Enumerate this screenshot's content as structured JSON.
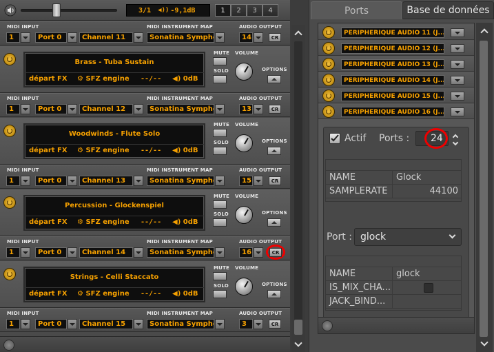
{
  "topbar": {
    "bar": "3/1",
    "volume": "-9,1dB",
    "pages": [
      "1",
      "2",
      "3",
      "4"
    ]
  },
  "labels": {
    "midi_input": "MIDI INPUT",
    "midi_map": "MIDI INSTRUMENT MAP",
    "audio_output": "AUDIO OUTPUT",
    "mute": "MUTE",
    "solo": "SOLO",
    "volume": "VOLUME",
    "options": "OPTIONS",
    "cr": "CR"
  },
  "midi_rows": [
    {
      "input": "1",
      "port": "Port 0",
      "channel": "Channel 11",
      "map": "Sonatina Sympho...",
      "output": "14"
    },
    {
      "input": "1",
      "port": "Port 0",
      "channel": "Channel 12",
      "map": "Sonatina Sympho...",
      "output": "13"
    },
    {
      "input": "1",
      "port": "Port 0",
      "channel": "Channel 13",
      "map": "Sonatina Sympho...",
      "output": "15"
    },
    {
      "input": "1",
      "port": "Port 0",
      "channel": "Channel 14",
      "map": "Sonatina Sympho...",
      "output": "16"
    },
    {
      "input": "1",
      "port": "Port 0",
      "channel": "Channel 15",
      "map": "Sonatina Sympho...",
      "output": "3"
    }
  ],
  "instruments": [
    {
      "title": "Brass - Tuba Sustain",
      "fx": "départ FX",
      "engine": "SFZ engine",
      "time": "--/--",
      "db": "0dB"
    },
    {
      "title": "Woodwinds - Flute Solo",
      "fx": "départ FX",
      "engine": "SFZ engine",
      "time": "--/--",
      "db": "0dB"
    },
    {
      "title": "Percussion - Glockenspiel",
      "fx": "départ FX",
      "engine": "SFZ engine",
      "time": "--/--",
      "db": "0dB"
    },
    {
      "title": "Strings - Celli Staccato",
      "fx": "départ FX",
      "engine": "SFZ engine",
      "time": "--/--",
      "db": "0dB"
    }
  ],
  "tabs": {
    "ports": "Ports",
    "database": "Base de données"
  },
  "devices": [
    "PERIPHERIQUE AUDIO 11 (J...",
    "PERIPHERIQUE AUDIO 12 (J...",
    "PERIPHERIQUE AUDIO 13 (J...",
    "PERIPHERIQUE AUDIO 14 (J...",
    "PERIPHERIQUE AUDIO 15 (J...",
    "PERIPHERIQUE AUDIO 16 (J..."
  ],
  "device_props": {
    "active_label": "Actif",
    "ports_label": "Ports :",
    "ports_value": "24",
    "table": [
      {
        "key": "NAME",
        "value": "Glock"
      },
      {
        "key": "SAMPLERATE",
        "value": "44100"
      }
    ],
    "port_label": "Port :",
    "port_value": "glock",
    "port_table": [
      {
        "key": "NAME",
        "value": "glock"
      },
      {
        "key": "IS_MIX_CHA...",
        "value": ""
      },
      {
        "key": "JACK_BIND...",
        "value": ""
      }
    ]
  },
  "colors": {
    "accent": "#f5a000",
    "highlight": "#e00000"
  }
}
